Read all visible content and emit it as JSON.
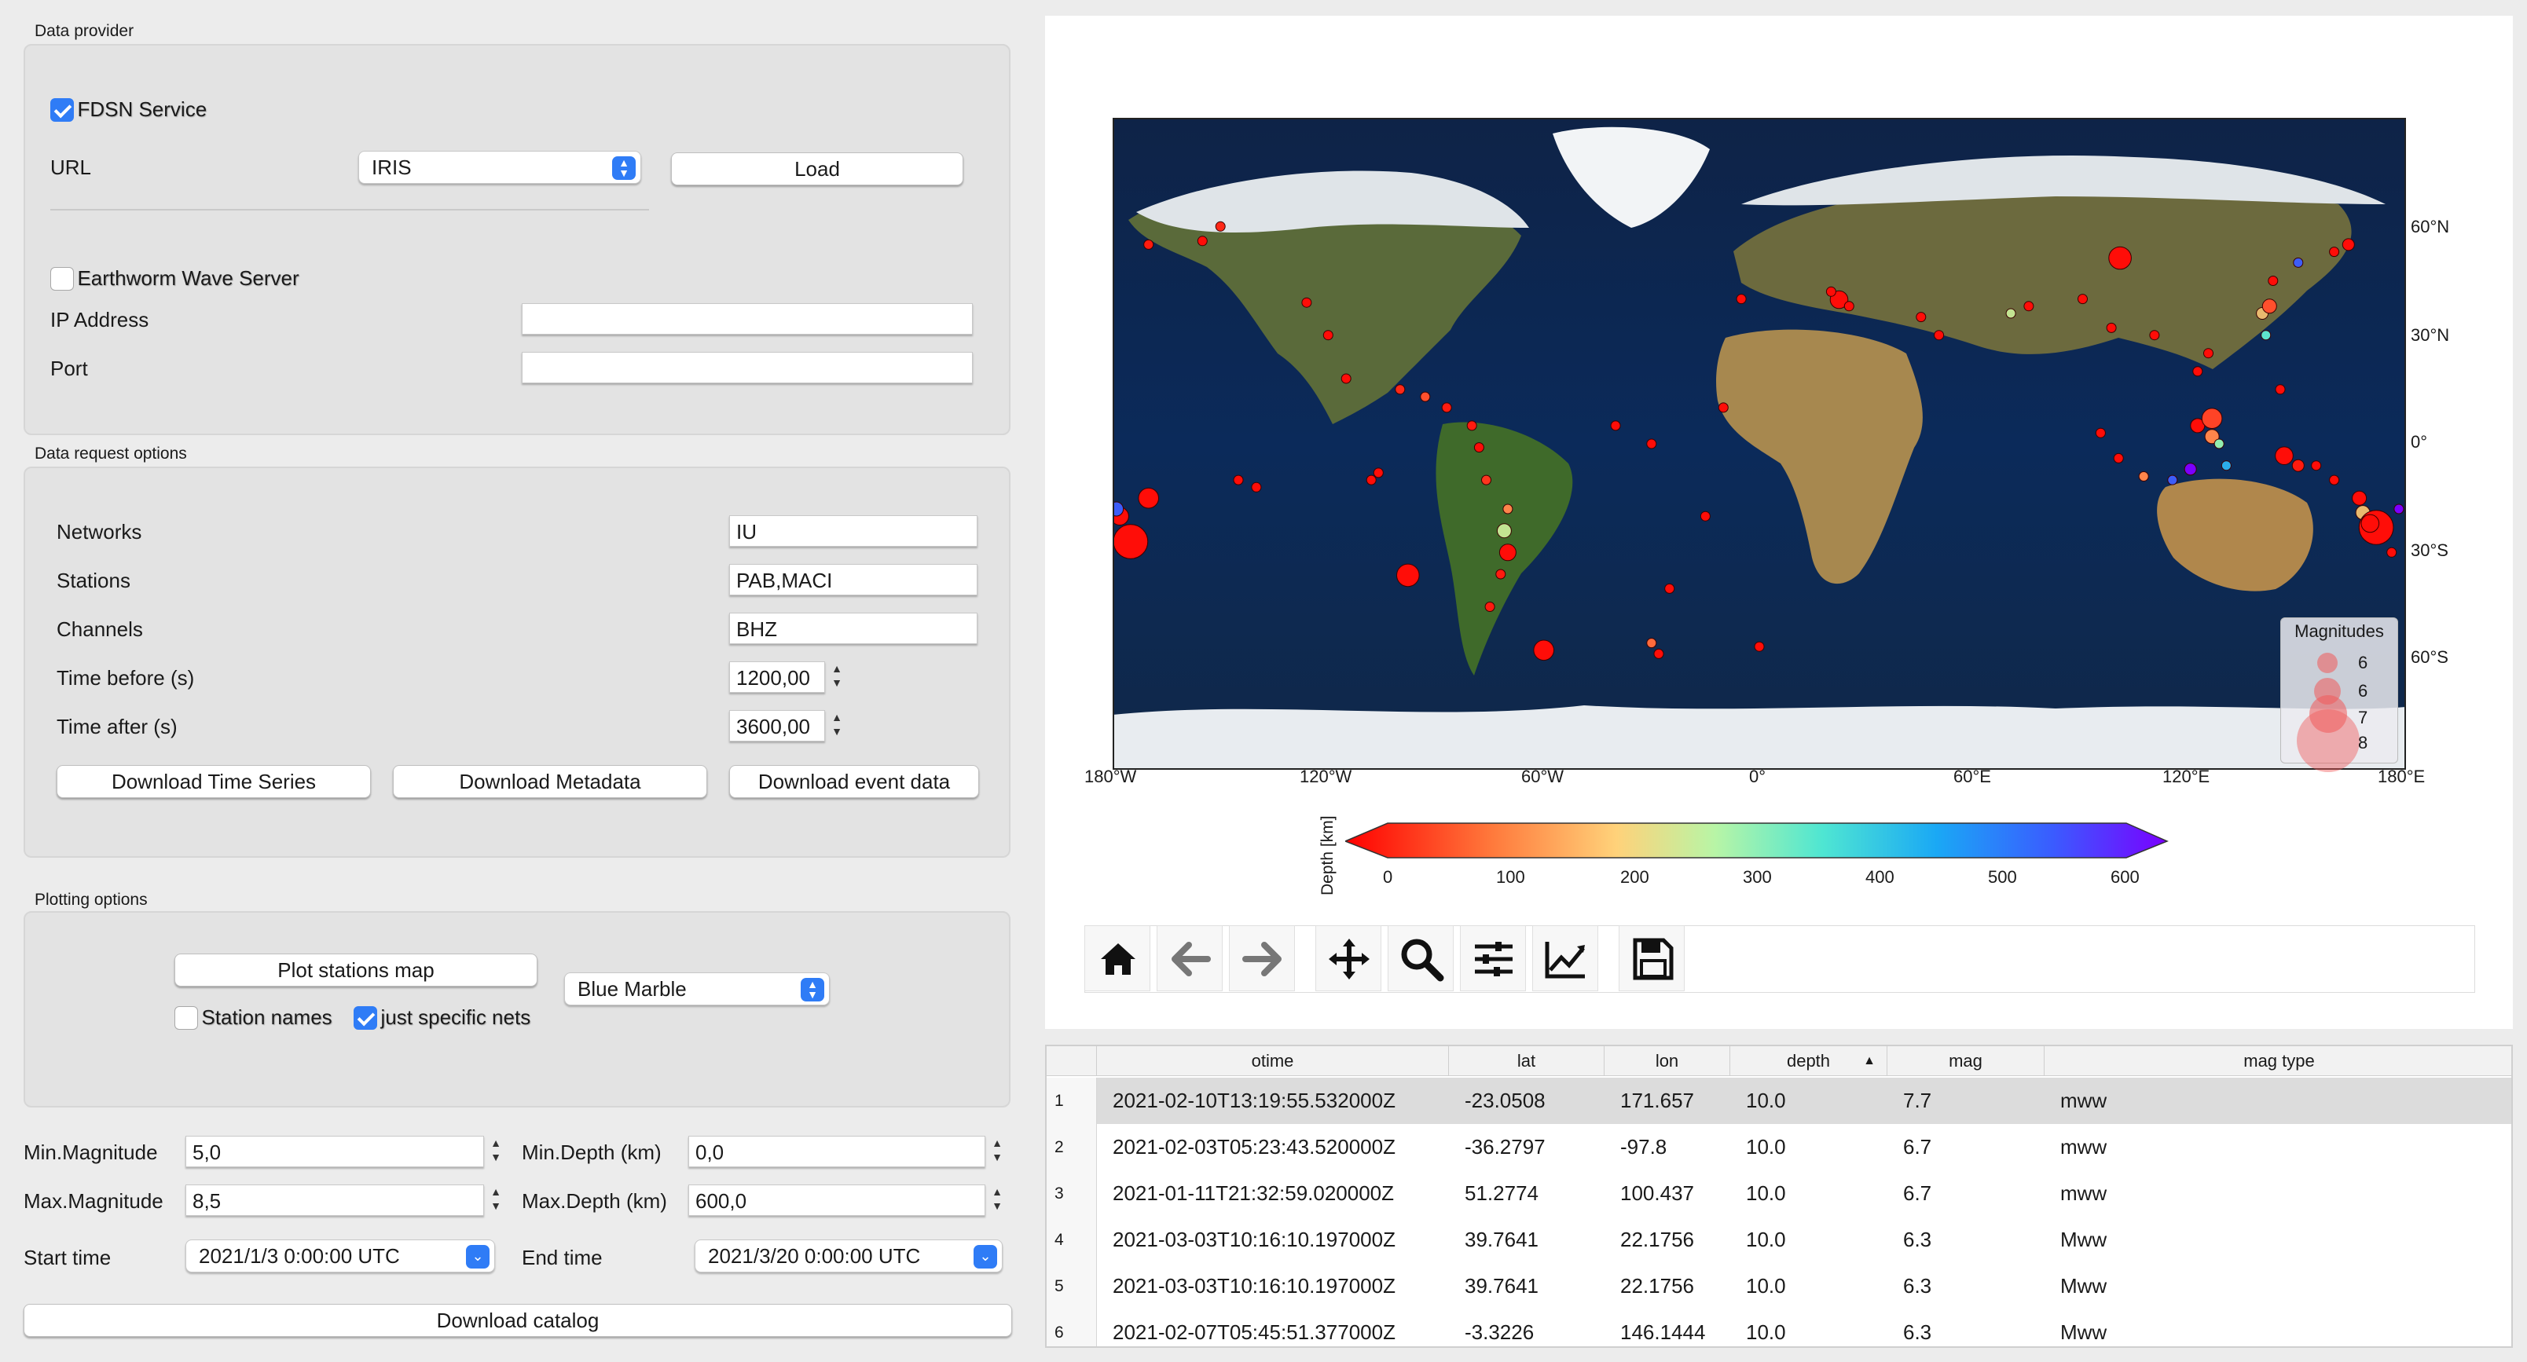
{
  "data_provider": {
    "title": "Data provider",
    "fdsn_label": "FDSN Service",
    "fdsn_checked": true,
    "url_label": "URL",
    "url_value": "IRIS",
    "load_label": "Load",
    "earthworm_label": "Earthworm Wave Server",
    "earthworm_checked": false,
    "ip_label": "IP Address",
    "ip_value": "",
    "port_label": "Port",
    "port_value": ""
  },
  "request": {
    "title": "Data request options",
    "networks_label": "Networks",
    "networks_value": "IU",
    "stations_label": "Stations",
    "stations_value": "PAB,MACI",
    "channels_label": "Channels",
    "channels_value": "BHZ",
    "time_before_label": "Time before (s)",
    "time_before_value": "1200,00",
    "time_after_label": "Time after (s)",
    "time_after_value": "3600,00",
    "download_ts_label": "Download Time Series",
    "download_meta_label": "Download Metadata",
    "download_event_label": "Download event data"
  },
  "plotting": {
    "title": "Plotting options",
    "plot_map_label": "Plot stations map",
    "basemap_value": "Blue Marble",
    "station_names_label": "Station names",
    "station_names_checked": false,
    "specific_nets_label": "just specific nets",
    "specific_nets_checked": true
  },
  "catalog": {
    "min_mag_label": "Min.Magnitude",
    "min_mag_value": "5,0",
    "max_mag_label": "Max.Magnitude",
    "max_mag_value": "8,5",
    "min_depth_label": "Min.Depth (km)",
    "min_depth_value": "0,0",
    "max_depth_label": "Max.Depth (km)",
    "max_depth_value": "600,0",
    "start_label": "Start time",
    "start_value": "2021/1/3 0:00:00 UTC",
    "end_label": "End time",
    "end_value": "2021/3/20 0:00:00 UTC",
    "download_label": "Download catalog"
  },
  "map": {
    "lat_ticks": [
      "60°N",
      "30°N",
      "0°",
      "30°S",
      "60°S"
    ],
    "lon_ticks": [
      "180°W",
      "120°W",
      "60°W",
      "0°",
      "60°E",
      "120°E",
      "180°E"
    ],
    "legend_title": "Magnitudes",
    "legend_entries": [
      "6",
      "6",
      "7",
      "8"
    ],
    "colorbar_label": "Depth [km]",
    "colorbar_ticks": [
      "0",
      "100",
      "200",
      "300",
      "400",
      "500",
      "600"
    ],
    "colors": {
      "shallow": "#ff0000",
      "mid": "#b0f0a0",
      "deep": "#7a00ff"
    },
    "events": [
      {
        "lon": -175,
        "lat": -27,
        "mag": 7.7,
        "depth": 10
      },
      {
        "lon": -178,
        "lat": -20,
        "mag": 6.3,
        "depth": 10
      },
      {
        "lon": -179,
        "lat": -18,
        "mag": 6.0,
        "depth": 500
      },
      {
        "lon": -170,
        "lat": -15,
        "mag": 6.5,
        "depth": 10
      },
      {
        "lon": -170,
        "lat": 55,
        "mag": 5.5,
        "depth": 20
      },
      {
        "lon": -155,
        "lat": 56,
        "mag": 5.5,
        "depth": 10
      },
      {
        "lon": -150,
        "lat": 60,
        "mag": 5.3,
        "depth": 30
      },
      {
        "lon": -145,
        "lat": -10,
        "mag": 5.3,
        "depth": 10
      },
      {
        "lon": -140,
        "lat": -12,
        "mag": 5.3,
        "depth": 10
      },
      {
        "lon": -126,
        "lat": 39,
        "mag": 5.2,
        "depth": 10
      },
      {
        "lon": -120,
        "lat": 30,
        "mag": 5.2,
        "depth": 10
      },
      {
        "lon": -115,
        "lat": 18,
        "mag": 5.2,
        "depth": 10
      },
      {
        "lon": -108,
        "lat": -10,
        "mag": 5.5,
        "depth": 10
      },
      {
        "lon": -106,
        "lat": -8,
        "mag": 5.3,
        "depth": 10
      },
      {
        "lon": -100,
        "lat": 15,
        "mag": 5.3,
        "depth": 30
      },
      {
        "lon": -97.8,
        "lat": -36.3,
        "mag": 6.7,
        "depth": 10
      },
      {
        "lon": -93,
        "lat": 13,
        "mag": 5.5,
        "depth": 60
      },
      {
        "lon": -87,
        "lat": 10,
        "mag": 5.3,
        "depth": 20
      },
      {
        "lon": -80,
        "lat": 5,
        "mag": 5.3,
        "depth": 20
      },
      {
        "lon": -78,
        "lat": -1,
        "mag": 5.5,
        "depth": 10
      },
      {
        "lon": -76,
        "lat": -10,
        "mag": 5.5,
        "depth": 40
      },
      {
        "lon": -70,
        "lat": -18,
        "mag": 5.5,
        "depth": 100
      },
      {
        "lon": -71,
        "lat": -24,
        "mag": 6.0,
        "depth": 200
      },
      {
        "lon": -70,
        "lat": -30,
        "mag": 6.2,
        "depth": 10
      },
      {
        "lon": -72,
        "lat": -36,
        "mag": 5.5,
        "depth": 20
      },
      {
        "lon": -75,
        "lat": -45,
        "mag": 5.3,
        "depth": 20
      },
      {
        "lon": -60,
        "lat": -57,
        "mag": 6.5,
        "depth": 10
      },
      {
        "lon": -30,
        "lat": -55,
        "mag": 5.5,
        "depth": 80
      },
      {
        "lon": -28,
        "lat": -58,
        "mag": 5.5,
        "depth": 10
      },
      {
        "lon": -40,
        "lat": 5,
        "mag": 5.3,
        "depth": 10
      },
      {
        "lon": -30,
        "lat": 0,
        "mag": 5.3,
        "depth": 10
      },
      {
        "lon": -25,
        "lat": -40,
        "mag": 5.3,
        "depth": 10
      },
      {
        "lon": -15,
        "lat": -20,
        "mag": 5.3,
        "depth": 10
      },
      {
        "lon": -10,
        "lat": 10,
        "mag": 5.3,
        "depth": 10
      },
      {
        "lon": 0,
        "lat": -56,
        "mag": 5.3,
        "depth": 10
      },
      {
        "lon": -5,
        "lat": 40,
        "mag": 5.5,
        "depth": 10
      },
      {
        "lon": 22.2,
        "lat": 39.8,
        "mag": 6.3,
        "depth": 10
      },
      {
        "lon": 25,
        "lat": 38,
        "mag": 5.5,
        "depth": 10
      },
      {
        "lon": 20,
        "lat": 42,
        "mag": 5.3,
        "depth": 10
      },
      {
        "lon": 45,
        "lat": 35,
        "mag": 5.3,
        "depth": 10
      },
      {
        "lon": 50,
        "lat": 30,
        "mag": 5.3,
        "depth": 10
      },
      {
        "lon": 70,
        "lat": 36,
        "mag": 5.5,
        "depth": 200
      },
      {
        "lon": 75,
        "lat": 38,
        "mag": 5.5,
        "depth": 10
      },
      {
        "lon": 90,
        "lat": 40,
        "mag": 5.3,
        "depth": 10
      },
      {
        "lon": 100.4,
        "lat": 51.3,
        "mag": 6.7,
        "depth": 10
      },
      {
        "lon": 98,
        "lat": 32,
        "mag": 5.3,
        "depth": 10
      },
      {
        "lon": 110,
        "lat": 30,
        "mag": 5.3,
        "depth": 10
      },
      {
        "lon": 95,
        "lat": 3,
        "mag": 5.5,
        "depth": 10
      },
      {
        "lon": 100,
        "lat": -4,
        "mag": 5.5,
        "depth": 10
      },
      {
        "lon": 107,
        "lat": -9,
        "mag": 5.5,
        "depth": 100
      },
      {
        "lon": 115,
        "lat": -10,
        "mag": 5.5,
        "depth": 500
      },
      {
        "lon": 120,
        "lat": -7,
        "mag": 5.8,
        "depth": 600
      },
      {
        "lon": 122,
        "lat": 5,
        "mag": 6.0,
        "depth": 10
      },
      {
        "lon": 126,
        "lat": 7,
        "mag": 6.5,
        "depth": 50
      },
      {
        "lon": 126,
        "lat": 2,
        "mag": 6.0,
        "depth": 100
      },
      {
        "lon": 128,
        "lat": 0,
        "mag": 5.5,
        "depth": 250
      },
      {
        "lon": 130,
        "lat": -6,
        "mag": 5.5,
        "depth": 400
      },
      {
        "lon": 122,
        "lat": 20,
        "mag": 5.3,
        "depth": 10
      },
      {
        "lon": 125,
        "lat": 25,
        "mag": 5.3,
        "depth": 10
      },
      {
        "lon": 140,
        "lat": 36,
        "mag": 5.8,
        "depth": 150
      },
      {
        "lon": 142,
        "lat": 38,
        "mag": 6.0,
        "depth": 60
      },
      {
        "lon": 141,
        "lat": 30,
        "mag": 5.5,
        "depth": 300
      },
      {
        "lon": 143,
        "lat": 45,
        "mag": 5.5,
        "depth": 10
      },
      {
        "lon": 150,
        "lat": 50,
        "mag": 5.5,
        "depth": 500
      },
      {
        "lon": 160,
        "lat": 53,
        "mag": 5.5,
        "depth": 10
      },
      {
        "lon": 164,
        "lat": 55,
        "mag": 5.8,
        "depth": 10
      },
      {
        "lon": 145,
        "lat": 15,
        "mag": 5.3,
        "depth": 10
      },
      {
        "lon": 146.1,
        "lat": -3.3,
        "mag": 6.3,
        "depth": 10
      },
      {
        "lon": 150,
        "lat": -6,
        "mag": 5.8,
        "depth": 20
      },
      {
        "lon": 155,
        "lat": -6,
        "mag": 5.5,
        "depth": 10
      },
      {
        "lon": 160,
        "lat": -10,
        "mag": 5.5,
        "depth": 10
      },
      {
        "lon": 167,
        "lat": -15,
        "mag": 6.0,
        "depth": 10
      },
      {
        "lon": 168,
        "lat": -19,
        "mag": 6.0,
        "depth": 150
      },
      {
        "lon": 171.7,
        "lat": -23.1,
        "mag": 7.7,
        "depth": 10
      },
      {
        "lon": 170,
        "lat": -22,
        "mag": 6.3,
        "depth": 10
      },
      {
        "lon": 176,
        "lat": -30,
        "mag": 5.5,
        "depth": 10
      },
      {
        "lon": 178,
        "lat": -18,
        "mag": 5.5,
        "depth": 600
      }
    ]
  },
  "toolbar": {
    "home": "home-icon",
    "back": "arrow-left-icon",
    "forward": "arrow-right-icon",
    "pan": "move-icon",
    "zoom": "zoom-icon",
    "configure": "sliders-icon",
    "edit_axes": "chart-icon",
    "save": "save-icon"
  },
  "table": {
    "columns": [
      "otime",
      "lat",
      "lon",
      "depth",
      "mag",
      "mag type"
    ],
    "rows": [
      [
        "1",
        "2021-02-10T13:19:55.532000Z",
        "-23.0508",
        "171.657",
        "10.0",
        "7.7",
        "mww"
      ],
      [
        "2",
        "2021-02-03T05:23:43.520000Z",
        "-36.2797",
        "-97.8",
        "10.0",
        "6.7",
        "mww"
      ],
      [
        "3",
        "2021-01-11T21:32:59.020000Z",
        "51.2774",
        "100.437",
        "10.0",
        "6.7",
        "mww"
      ],
      [
        "4",
        "2021-03-03T10:16:10.197000Z",
        "39.7641",
        "22.1756",
        "10.0",
        "6.3",
        "Mww"
      ],
      [
        "5",
        "2021-03-03T10:16:10.197000Z",
        "39.7641",
        "22.1756",
        "10.0",
        "6.3",
        "Mww"
      ],
      [
        "6",
        "2021-02-07T05:45:51.377000Z",
        "-3.3226",
        "146.1444",
        "10.0",
        "6.3",
        "Mww"
      ]
    ]
  }
}
